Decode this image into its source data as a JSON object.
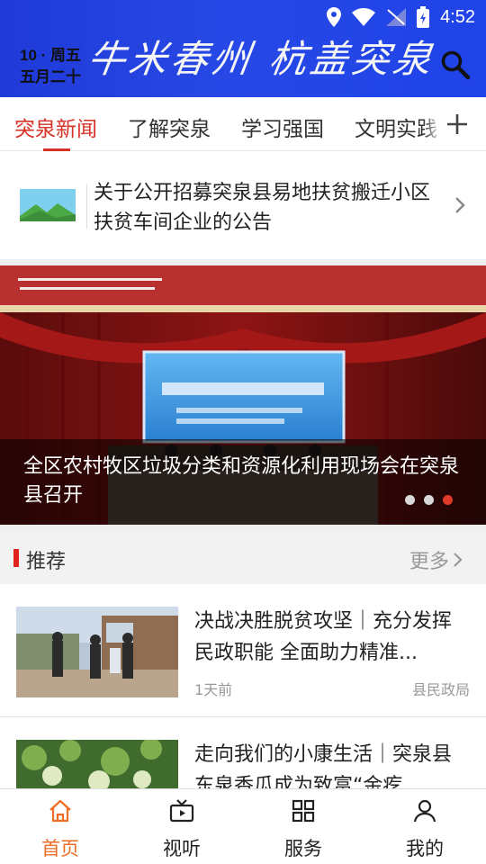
{
  "status_bar": {
    "time": "4:52"
  },
  "header": {
    "date_line1": "10 · 周五",
    "date_line2": "五月二十",
    "brand_title": "牛米春州  杭盖突泉"
  },
  "tabs": [
    {
      "label": "突泉新闻",
      "active": true
    },
    {
      "label": "了解突泉",
      "active": false
    },
    {
      "label": "学习强国",
      "active": false
    },
    {
      "label": "文明实践",
      "active": false
    }
  ],
  "notice": {
    "text": "关于公开招募突泉县易地扶贫搬迁小区扶贫车间企业的公告"
  },
  "banner": {
    "caption": "全区农村牧区垃圾分类和资源化利用现场会在突泉县召开",
    "slides": 3,
    "active_slide": 3
  },
  "recommend": {
    "title": "推荐",
    "more_label": "更多"
  },
  "news": [
    {
      "title": "决战决胜脱贫攻坚｜充分发挥民政职能 全面助力精准...",
      "time": "1天前",
      "source": "县民政局"
    },
    {
      "title": "走向我们的小康生活｜突泉县东泉香瓜成为致富“金疙",
      "time": "",
      "source": ""
    }
  ],
  "bottom_nav": [
    {
      "label": "首页",
      "icon": "home-icon",
      "active": true
    },
    {
      "label": "视听",
      "icon": "tv-icon",
      "active": false
    },
    {
      "label": "服务",
      "icon": "grid-icon",
      "active": false
    },
    {
      "label": "我的",
      "icon": "user-icon",
      "active": false
    }
  ],
  "colors": {
    "accent": "#d63226",
    "header_blue": "#2748e6",
    "nav_active": "#ee6d24"
  }
}
